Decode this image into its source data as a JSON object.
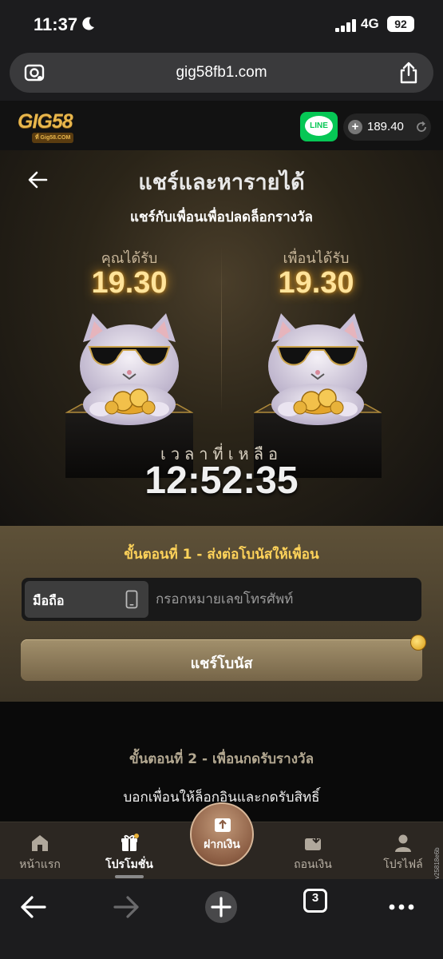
{
  "status_bar": {
    "time": "11:37",
    "network": "4G",
    "battery": "92"
  },
  "browser": {
    "url": "gig58fb1.com",
    "tab_count": "3"
  },
  "site_header": {
    "logo_text": "GIG58",
    "logo_sub": "ที่ Gig58.COM",
    "line_label": "LINE",
    "balance": "189.40"
  },
  "hero": {
    "title": "แชร์และหารายได้",
    "subtitle": "แชร์กับเพื่อนเพื่อปลดล็อกรางวัล",
    "you_get_label": "คุณได้รับ",
    "you_get_value": "19.30",
    "friend_get_label": "เพื่อนได้รับ",
    "friend_get_value": "19.30",
    "timer_label": "เวลาที่เหลือ",
    "timer_value": "12:52:35"
  },
  "step1": {
    "title": "ขั้นตอนที่ 1 - ส่งต่อโบนัสให้เพื่อน",
    "phone_tag": "มือถือ",
    "phone_placeholder": "กรอกหมายเลขโทรศัพท์",
    "share_button": "แชร์โบนัส"
  },
  "step2": {
    "title": "ขั้นตอนที่ 2 - เพื่อนกดรับรางวัล",
    "description": "บอกเพื่อนให้ล็อกอินและกดรับสิทธิ์"
  },
  "bottom_nav": {
    "home": "หน้าแรก",
    "promotions": "โปรโมชั่น",
    "deposit": "ฝากเงิน",
    "withdraw": "ถอนเงิน",
    "profile": "โปรไฟล์"
  },
  "version": "v25818e6b",
  "colors": {
    "accent_gold": "#ffd35a",
    "line_green": "#06c755",
    "reward_glow": "#ffe39a"
  }
}
